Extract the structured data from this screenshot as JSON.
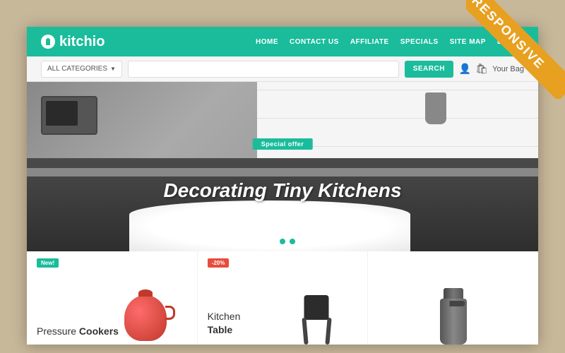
{
  "badge": {
    "text": "RESPONSIVE"
  },
  "logo": {
    "name": "kitchio",
    "icon": "🍴"
  },
  "nav": {
    "items": [
      {
        "label": "HOME"
      },
      {
        "label": "CONTACT US"
      },
      {
        "label": "AFFILIATE"
      },
      {
        "label": "SPECIALS"
      },
      {
        "label": "SITE MAP"
      },
      {
        "label": "BLOGS"
      }
    ]
  },
  "search": {
    "category_placeholder": "ALL CATEGORIES",
    "input_placeholder": "",
    "button_label": "SEARCH",
    "cart_label": "Your Bag"
  },
  "hero": {
    "badge": "Special offer",
    "headline": "Decorating Tiny Kitchens",
    "dots": [
      {
        "active": true
      },
      {
        "active": false
      },
      {
        "active": true
      }
    ]
  },
  "products": [
    {
      "badge": "New!",
      "badge_type": "new",
      "title_prefix": "Pressure ",
      "title_bold": "Cookers",
      "image_type": "kettle"
    },
    {
      "badge": "-20%",
      "badge_type": "discount",
      "title_prefix": "Kitchen\n",
      "title_bold": "Table",
      "image_type": "stool"
    },
    {
      "badge": "",
      "badge_type": "",
      "title_prefix": "",
      "title_bold": "",
      "image_type": "tap"
    }
  ]
}
